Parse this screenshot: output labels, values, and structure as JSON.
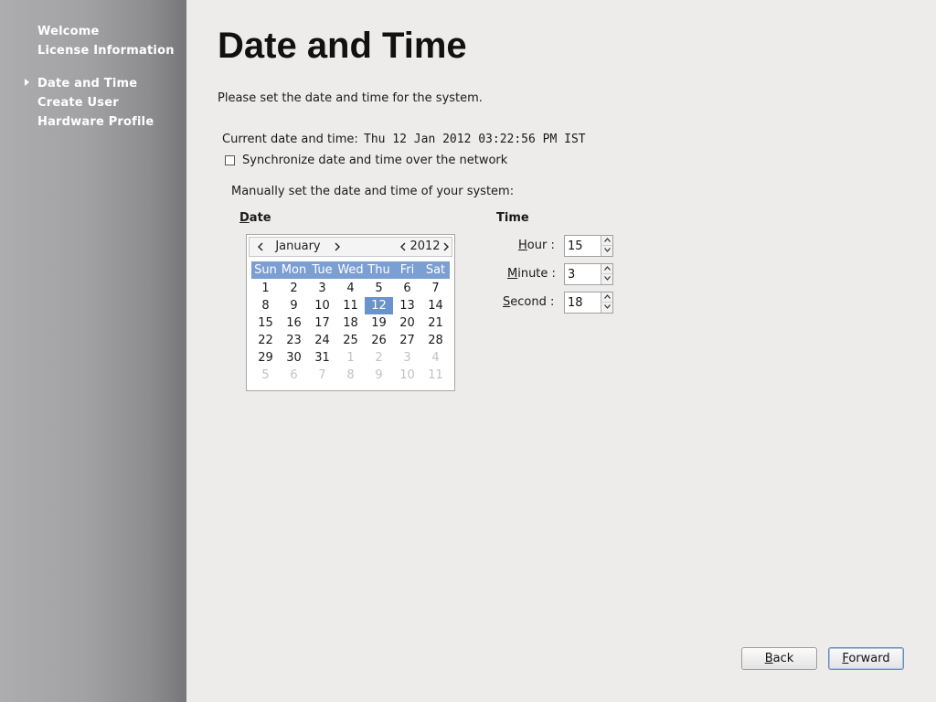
{
  "sidebar": {
    "items": [
      {
        "label": "Welcome"
      },
      {
        "label": "License Information"
      },
      {
        "label": "Date and Time"
      },
      {
        "label": "Create User"
      },
      {
        "label": "Hardware Profile"
      }
    ],
    "active_index": 2
  },
  "page": {
    "title": "Date and Time",
    "intro": "Please set the date and time for the system."
  },
  "current": {
    "label": "Current date and time:",
    "value": "Thu  12  Jan  2012  03:22:56  PM  IST"
  },
  "sync": {
    "label": "Synchronize date and time over the network",
    "checked": false
  },
  "manual": {
    "label": "Manually set the date and time of your system:"
  },
  "date": {
    "heading_mnemonic": "D",
    "heading_rest": "ate",
    "calendar": {
      "month": "January",
      "year": "2012",
      "weekdays": [
        "Sun",
        "Mon",
        "Tue",
        "Wed",
        "Thu",
        "Fri",
        "Sat"
      ],
      "weeks": [
        [
          "1",
          "2",
          "3",
          "4",
          "5",
          "6",
          "7"
        ],
        [
          "8",
          "9",
          "10",
          "11",
          "12",
          "13",
          "14"
        ],
        [
          "15",
          "16",
          "17",
          "18",
          "19",
          "20",
          "21"
        ],
        [
          "22",
          "23",
          "24",
          "25",
          "26",
          "27",
          "28"
        ],
        [
          "29",
          "30",
          "31",
          "1",
          "2",
          "3",
          "4"
        ],
        [
          "5",
          "6",
          "7",
          "8",
          "9",
          "10",
          "11"
        ]
      ],
      "selected_day": "12"
    }
  },
  "time": {
    "heading": "Time",
    "hour": {
      "mnemonic": "H",
      "rest": "our :",
      "value": "15"
    },
    "minute": {
      "mnemonic": "M",
      "rest": "inute :",
      "value": "3"
    },
    "second": {
      "mnemonic": "S",
      "rest": "econd :",
      "value": "18"
    }
  },
  "buttons": {
    "back": {
      "mnemonic": "B",
      "rest": "ack"
    },
    "forward": {
      "mnemonic": "F",
      "rest": "orward"
    }
  },
  "icons": [
    "chevron-left-icon",
    "chevron-right-icon",
    "arrow-up-icon",
    "arrow-down-icon",
    "caret-right-icon"
  ],
  "colors": {
    "calendar_header_bg": "#7b9ed3",
    "selected_day_bg": "#6b93cb",
    "sidebar_text": "#ffffff"
  }
}
